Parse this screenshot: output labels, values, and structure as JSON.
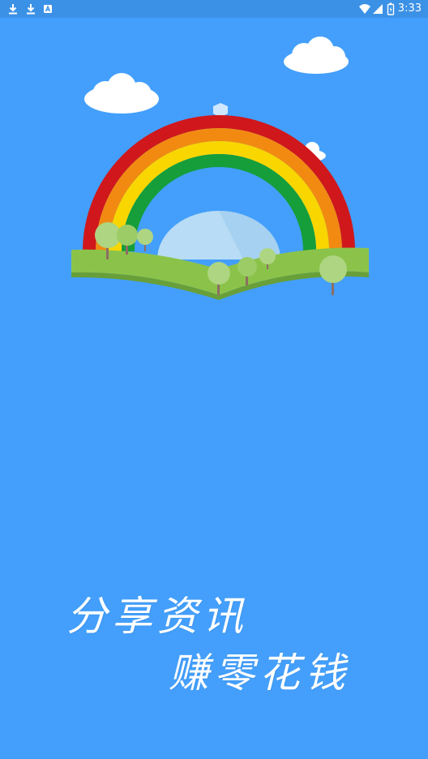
{
  "status_bar": {
    "time": "3:33",
    "left_icons": [
      "download-icon",
      "download-icon",
      "app-notification-icon"
    ],
    "right_icons": [
      "wifi-icon",
      "cell-signal-icon",
      "battery-icon"
    ]
  },
  "slogan": {
    "line1": "分享资讯",
    "line2": "赚零花钱"
  },
  "colors": {
    "background": "#439ffb",
    "rainbow": [
      "#d0171b",
      "#f28a11",
      "#f9d600",
      "#159e3a"
    ],
    "hill": "#8bc34a",
    "cloud": "#ffffff"
  }
}
